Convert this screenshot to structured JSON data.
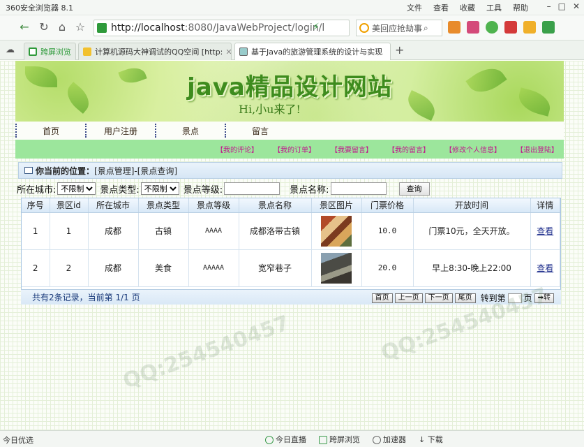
{
  "browser": {
    "app_title": "360安全浏览器 8.1",
    "menus": [
      "文件",
      "查看",
      "收藏",
      "工具",
      "帮助"
    ],
    "url_host": "http://localhost",
    "url_rest": ":8080/JavaWebProject/login/l",
    "search_placeholder": "美回应抢劫事",
    "tabs": [
      {
        "label": "跨屏浏览"
      },
      {
        "label": "计算机源码大神调试的QQ空间 [http:"
      },
      {
        "label": "基于Java的旅游管理系统的设计与实现"
      }
    ],
    "status_left": "今日优选",
    "status_items": [
      "今日直播",
      "跨屏浏览",
      "加速器",
      "下载"
    ]
  },
  "site": {
    "title": "java精品设计网站",
    "subtitle": "Hi,小u来了!",
    "nav": [
      "首页",
      "用户注册",
      "景点",
      "留言"
    ],
    "user_links": [
      "【我的评论】",
      "【我的订单】",
      "【我要留言】",
      "【我的留言】",
      "【修改个人信息】",
      "【退出登陆】"
    ]
  },
  "location": {
    "label": "你当前的位置：",
    "path": "[景点管理]-[景点查询]"
  },
  "filter": {
    "city_label": "所在城市:",
    "city_value": "不限制",
    "type_label": "景点类型:",
    "type_value": "不限制",
    "level_label": "景点等级:",
    "name_label": "景点名称:",
    "search_button": "查询"
  },
  "table": {
    "headers": [
      "序号",
      "景区id",
      "所在城市",
      "景点类型",
      "景点等级",
      "景点名称",
      "景区图片",
      "门票价格",
      "开放时间",
      "详情"
    ],
    "rows": [
      {
        "seq": "1",
        "id": "1",
        "city": "成都",
        "type": "古镇",
        "level": "AAAA",
        "name": "成都洛带古镇",
        "price": "10.0",
        "hours": "门票10元，全天开放。",
        "detail": "查看"
      },
      {
        "seq": "2",
        "id": "2",
        "city": "成都",
        "type": "美食",
        "level": "AAAAA",
        "name": "宽窄巷子",
        "price": "20.0",
        "hours": "早上8:30-晚上22:00",
        "detail": "查看"
      }
    ]
  },
  "pager": {
    "summary": "共有2条记录，当前第 1/1 页",
    "first": "首页",
    "prev": "上一页",
    "next": "下一页",
    "last": "尾页",
    "goto_label": "转到第",
    "page_unit": "页",
    "goto_button": "➡转"
  },
  "colors": {
    "nav_green": "#9ce69c",
    "user_link": "#c0188c",
    "title_green": "#3e8c1e"
  }
}
